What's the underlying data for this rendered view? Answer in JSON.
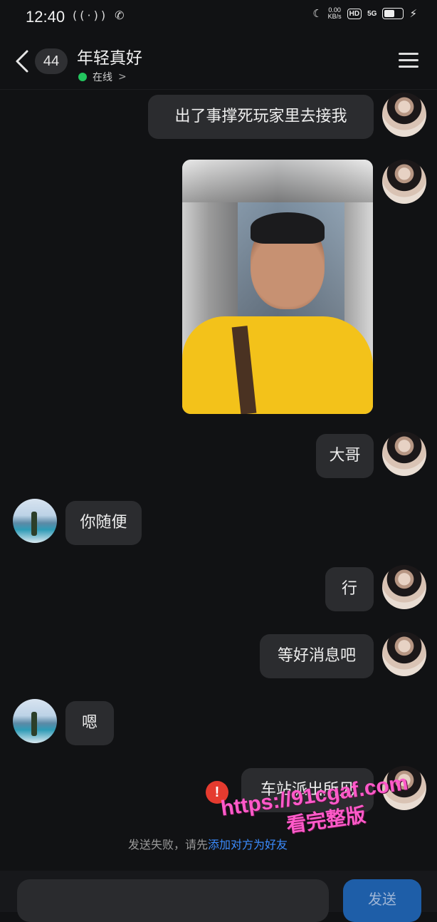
{
  "status_bar": {
    "time": "12:40",
    "icons_left": "((·)) ✆",
    "net_speed": "0.00",
    "net_unit": "KB/s",
    "hd": "HD",
    "signal": "5G"
  },
  "header": {
    "unread_count": "44",
    "title": "年轻真好",
    "status": "在线"
  },
  "messages": [
    {
      "text": "出了事撑死玩家里去接我"
    },
    {
      "text": "大哥"
    },
    {
      "text": "你随便"
    },
    {
      "text": "行"
    },
    {
      "text": "等好消息吧"
    },
    {
      "text": "嗯"
    },
    {
      "text": "车站派出所见"
    }
  ],
  "error": {
    "icon": "!",
    "notice": "发送失败，请先",
    "link": "添加对方为好友"
  },
  "watermark": {
    "line1": "https://91cgaf.com",
    "line2": "看完整版"
  },
  "composer": {
    "send_label": "发送"
  },
  "colors": {
    "background": "#111214",
    "bubble": "#2b2c2f",
    "online_dot": "#23c55e",
    "send_button": "#1e5ea8",
    "error": "#e53b2f",
    "link": "#3b8cff",
    "watermark": "#ff5ac9"
  }
}
